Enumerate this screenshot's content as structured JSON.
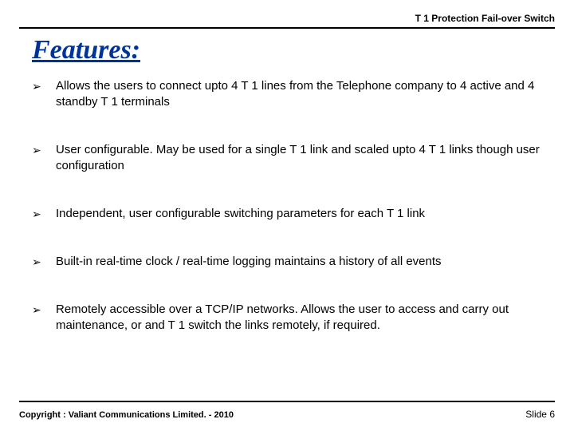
{
  "header": "T 1 Protection Fail-over Switch",
  "title": "Features:",
  "bullets": [
    "Allows the users to connect upto 4 T 1 lines from the Telephone company to 4 active and 4 standby T 1 terminals",
    "User configurable. May be used for a single T 1 link and scaled upto 4 T 1 links though user configuration",
    "Independent, user configurable switching parameters for each T 1 link",
    "Built-in real-time clock / real-time logging maintains a history of all events",
    "Remotely accessible over a TCP/IP networks. Allows the user to access and carry out maintenance, or and T 1 switch the links remotely, if required."
  ],
  "bullet_glyph": "➢",
  "copyright": "Copyright : Valiant Communications Limited. - 2010",
  "slide": "Slide 6"
}
